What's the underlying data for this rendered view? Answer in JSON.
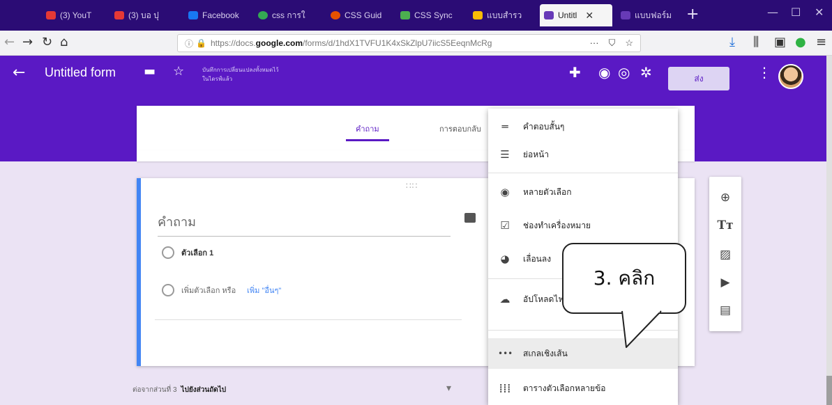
{
  "browser": {
    "tabs": [
      {
        "label": "(3) YouT",
        "color": "#e53935"
      },
      {
        "label": "(3) บอ ปุ",
        "color": "#e53935"
      },
      {
        "label": "Facebook",
        "color": "#1877f2"
      },
      {
        "label": "css การใ",
        "color": "#34a853"
      },
      {
        "label": "CSS Guid",
        "color": "#e65100"
      },
      {
        "label": "CSS Sync",
        "color": "#4caf50"
      },
      {
        "label": "แบบสำรว",
        "color": "#fbbc05"
      },
      {
        "label": "Untitl",
        "color": "#673ab7"
      },
      {
        "label": "แบบฟอร์ม",
        "color": "#673ab7"
      }
    ],
    "active_tab_close": "✕",
    "new_tab": "+",
    "url_prefix": "https://docs.",
    "url_domain": "google.com",
    "url_path": "/forms/d/1hdX1TVFU1K4xSkZlpU7iicS5EeqnMcRg",
    "url_more": "···"
  },
  "form": {
    "title": "Untitled form",
    "save_notice_line1": "บันทึกการเปลี่ยนแปลงทั้งหมดไว้",
    "save_notice_line2": "ในไดรฟ์แล้ว",
    "send_label": "ส่ง",
    "tabs": {
      "questions": "คำถาม",
      "responses": "การตอบกลับ"
    },
    "question_title": "คำถาม",
    "option1": "ตัวเลือก 1",
    "add_option": "เพิ่มตัวเลือก หรือ",
    "add_other": "เพิ่ม \"อื่นๆ\"",
    "section_prefix": "ต่อจากส่วนที่ 3",
    "section_action": "ไปยังส่วนถัดไป"
  },
  "menu": {
    "items": [
      {
        "label": "คำตอบสั้นๆ",
        "icon": "short-text-icon"
      },
      {
        "label": "ย่อหน้า",
        "icon": "paragraph-icon"
      },
      {
        "label": "หลายตัวเลือก",
        "icon": "radio-icon"
      },
      {
        "label": "ช่องทำเครื่องหมาย",
        "icon": "checkbox-icon"
      },
      {
        "label": "เลื่อนลง",
        "icon": "dropdown-icon"
      },
      {
        "label": "อัปโหลดไฟล์",
        "icon": "upload-icon"
      },
      {
        "label": "สเกลเชิงเส้น",
        "icon": "linear-scale-icon"
      },
      {
        "label": "ตารางตัวเลือกหลายข้อ",
        "icon": "grid-icon"
      }
    ]
  },
  "callout": {
    "text": "3. คลิก"
  },
  "colors": {
    "brand": "#5a19c4",
    "accent": "#4285f4"
  }
}
